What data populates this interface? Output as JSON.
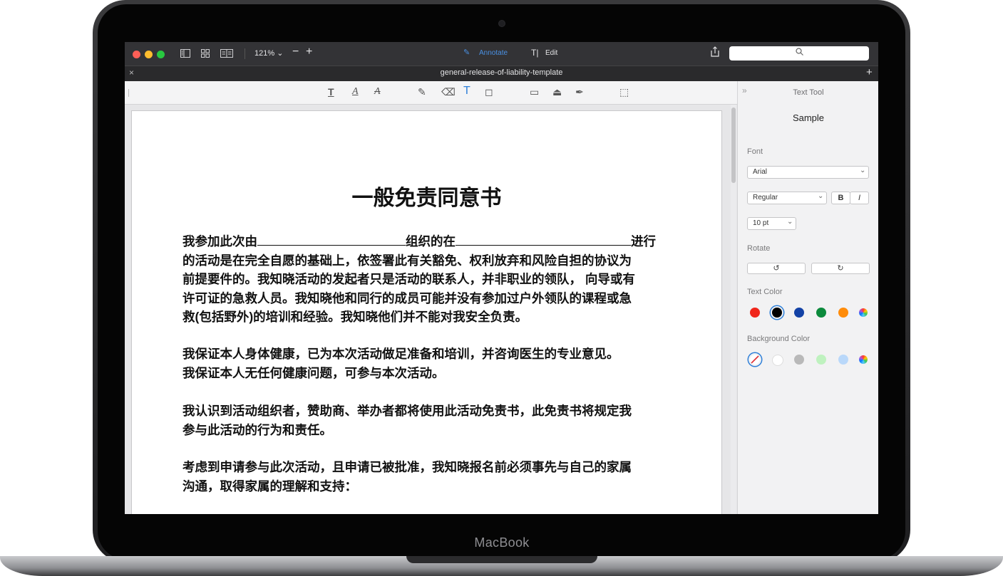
{
  "device": {
    "brand_label": "MacBook"
  },
  "window": {
    "zoom": "121%",
    "annotate_label": "Annotate",
    "edit_label": "Edit",
    "document_title": "general-release-of-liability-template"
  },
  "document": {
    "heading": "一般免责同意书",
    "para1_a": "我参加此次由",
    "para1_b": "组织的在",
    "para1_c": "进行",
    "para1_lines": [
      "的活动是在完全自愿的基础上，依签署此有关豁免、权利放弃和风险自担的协议为",
      "前提要件的。我知晓活动的发起者只是活动的联系人，并非职业的领队， 向导或有",
      "许可证的急救人员。我知晓他和同行的成员可能并没有参加过户外领队的课程或急",
      "救(包括野外)的培训和经验。我知晓他们并不能对我安全负责。"
    ],
    "para2_lines": [
      "我保证本人身体健康，已为本次活动做足准备和培训，并咨询医生的专业意见。",
      "我保证本人无任何健康问题，可参与本次活动。"
    ],
    "para3_lines": [
      "我认识到活动组织者，赞助商、举办者都将使用此活动免责书，此免责书将规定我",
      "参与此活动的行为和责任。"
    ],
    "para4_lines": [
      "考虑到申请参与此次活动，且申请已被批准，我知晓报名前必须事先与自己的家属",
      "沟通，取得家属的理解和支持："
    ]
  },
  "panel": {
    "title": "Text Tool",
    "sample": "Sample",
    "font_label": "Font",
    "font_value": "Arial",
    "style_value": "Regular",
    "bold_label": "B",
    "italic_label": "I",
    "size_value": "10 pt",
    "rotate_label": "Rotate",
    "text_color_label": "Text Color",
    "background_color_label": "Background Color",
    "text_colors": [
      "#f0261b",
      "#000000",
      "#1342a6",
      "#0c8a3c",
      "#ff8c0a"
    ],
    "background_colors": [
      "#ffffff",
      "#b9b9b9",
      "#bff2bf",
      "#b9d8fa"
    ]
  }
}
